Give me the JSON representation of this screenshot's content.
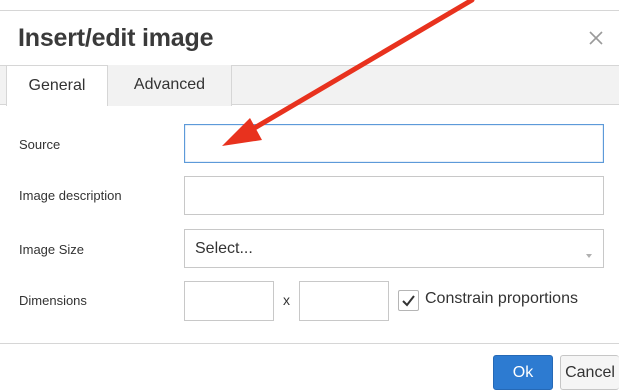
{
  "dialog": {
    "title": "Insert/edit image",
    "close_icon": "close-icon"
  },
  "tabs": [
    {
      "label": "General",
      "active": true
    },
    {
      "label": "Advanced",
      "active": false
    }
  ],
  "form": {
    "source": {
      "label": "Source",
      "value": ""
    },
    "image_description": {
      "label": "Image description",
      "value": ""
    },
    "image_size": {
      "label": "Image Size",
      "selected": "Select...",
      "caret_icon": "caret-down-icon"
    },
    "dimensions": {
      "label": "Dimensions",
      "width_value": "",
      "height_value": "",
      "separator": "x",
      "constrain_label": "Constrain proportions",
      "constrain_checked": true
    }
  },
  "buttons": {
    "ok_label": "Ok",
    "cancel_label": "Cancel"
  },
  "colors": {
    "ok_button": "#2d7bd1",
    "focus_border": "#5d9ad9",
    "annotation_arrow": "#e8321e"
  }
}
